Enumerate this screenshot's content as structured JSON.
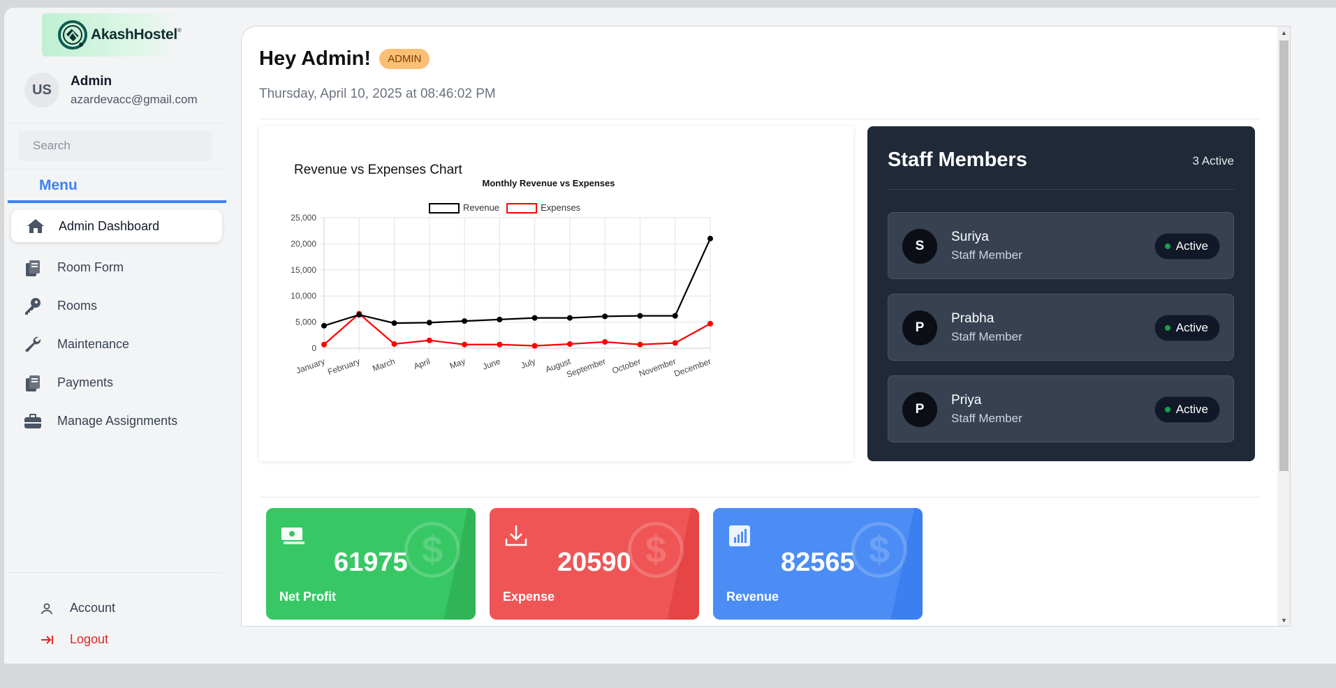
{
  "brand": {
    "name": "AkashHostel"
  },
  "profile": {
    "initials": "US",
    "name": "Admin",
    "email": "azardevacc@gmail.com"
  },
  "search": {
    "placeholder": "Search"
  },
  "menu": {
    "title": "Menu",
    "items": [
      {
        "label": "Admin Dashboard",
        "icon": "home-icon",
        "active": true
      },
      {
        "label": "Room Form",
        "icon": "clipboard-icon"
      },
      {
        "label": "Rooms",
        "icon": "key-icon"
      },
      {
        "label": "Maintenance",
        "icon": "wrench-icon"
      },
      {
        "label": "Payments",
        "icon": "clipboard-icon"
      },
      {
        "label": "Manage Assignments",
        "icon": "briefcase-icon"
      }
    ]
  },
  "bottom_nav": {
    "account": "Account",
    "logout": "Logout"
  },
  "header": {
    "greeting": "Hey Admin!",
    "role_badge": "ADMIN",
    "datetime": "Thursday, April 10, 2025 at 08:46:02 PM"
  },
  "chart_card": {
    "title": "Revenue vs Expenses Chart"
  },
  "chart_data": {
    "type": "line",
    "title": "Monthly Revenue vs Expenses",
    "categories": [
      "January",
      "February",
      "March",
      "April",
      "May",
      "June",
      "July",
      "August",
      "September",
      "October",
      "November",
      "December"
    ],
    "series": [
      {
        "name": "Revenue",
        "color": "#000000",
        "values": [
          4300,
          6400,
          4800,
          4900,
          5200,
          5500,
          5800,
          5800,
          6100,
          6200,
          6200,
          21000
        ]
      },
      {
        "name": "Expenses",
        "color": "#ff0000",
        "values": [
          700,
          6600,
          800,
          1500,
          700,
          700,
          450,
          800,
          1200,
          700,
          1000,
          4700
        ]
      }
    ],
    "ylim": [
      0,
      25000
    ],
    "yticks": [
      "0",
      "5,000",
      "10,000",
      "15,000",
      "20,000",
      "25,000"
    ],
    "grid": true,
    "legend": "top"
  },
  "staff": {
    "title": "Staff Members",
    "count": "3 Active",
    "members": [
      {
        "initial": "S",
        "name": "Suriya",
        "role": "Staff Member",
        "status": "Active"
      },
      {
        "initial": "P",
        "name": "Prabha",
        "role": "Staff Member",
        "status": "Active"
      },
      {
        "initial": "P",
        "name": "Priya",
        "role": "Staff Member",
        "status": "Active"
      }
    ]
  },
  "stats": [
    {
      "value": "61975",
      "label": "Net Profit",
      "color": "#37c865",
      "icon": "money-icon"
    },
    {
      "value": "20590",
      "label": "Expense",
      "color": "#ef5555",
      "icon": "download-icon"
    },
    {
      "value": "82565",
      "label": "Revenue",
      "color": "#4c8df5",
      "icon": "bar-chart-icon"
    }
  ]
}
